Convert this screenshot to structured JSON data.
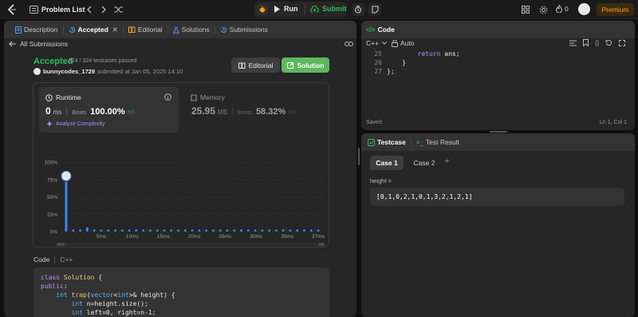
{
  "nav": {
    "problem_list": "Problem List",
    "run": "Run",
    "submit": "Submit",
    "streak": "0",
    "premium": "Premium"
  },
  "left_tabs": {
    "description": "Description",
    "accepted": "Accepted",
    "editorial": "Editorial",
    "solutions": "Solutions",
    "submissions": "Submissions"
  },
  "submission": {
    "back_label": "All Submissions",
    "status": "Accepted",
    "testcases": "324 / 324 testcases passed",
    "username": "bunnycodes_1729",
    "submitted_text": "submitted at Jan 05, 2025 14:10",
    "editorial_button": "Editorial",
    "solution_button": "Solution",
    "runtime": {
      "title": "Runtime",
      "value": "0",
      "unit": "ms",
      "beats_label": "Beats",
      "beats_value": "100.00%",
      "analyze": "Analyze Complexity"
    },
    "memory": {
      "title": "Memory",
      "value": "25.95",
      "unit": "MB",
      "beats_label": "Beats",
      "beats_value": "58.32%"
    }
  },
  "chart_data": {
    "type": "bar",
    "y_ticks": [
      "100%",
      "75%",
      "50%",
      "25%",
      "0%"
    ],
    "x_ticks": [
      "5ms",
      "10ms",
      "15ms",
      "20ms",
      "26ms",
      "30ms",
      "35ms",
      "37ms"
    ],
    "ylim": [
      0,
      100
    ],
    "values": [
      72,
      3,
      3,
      6,
      3,
      3,
      3,
      3,
      3,
      3,
      3,
      3,
      3,
      3,
      3,
      3,
      3,
      3,
      3,
      3,
      3,
      3,
      3,
      3,
      3,
      3,
      3,
      3,
      3,
      3,
      3,
      3,
      3,
      3,
      3,
      3,
      3
    ],
    "highlight_index": 0,
    "overview_ticks": [
      "5ms",
      "10ms",
      "15ms",
      "20ms",
      "25ms",
      "30ms",
      "37ms"
    ],
    "colors": {
      "bar": "#3c82f0",
      "bar_highlight": "#3c82f0"
    }
  },
  "code_section": {
    "label": "Code",
    "language": "C++",
    "lines": [
      "class Solution {",
      "public:",
      "    int trap(vector<int>& height) {",
      "        int n=height.size();",
      "        int left=0, right=n-1;"
    ]
  },
  "editor": {
    "title": "Code",
    "language": "C++",
    "mode": "Auto",
    "line_numbers": [
      "25",
      "26",
      "27"
    ],
    "lines": [
      "        return ans;",
      "    }",
      "};"
    ],
    "saved": "Saved",
    "cursor": "Ln 1, Col 1"
  },
  "testcase": {
    "tab": "Testcase",
    "result_tab": "Test Result",
    "cases": [
      "Case 1",
      "Case 2"
    ],
    "add": "+",
    "var_label": "height =",
    "value": "[0,1,0,2,1,0,1,3,2,1,2,1]"
  },
  "colors": {
    "accepted": "#2cbb5d",
    "solution_btn": "#5cb85c",
    "link_purple": "#a98bff",
    "premium": "#ffa116",
    "code_keyword": "#b596f8",
    "code_type": "#5ab4f0"
  }
}
